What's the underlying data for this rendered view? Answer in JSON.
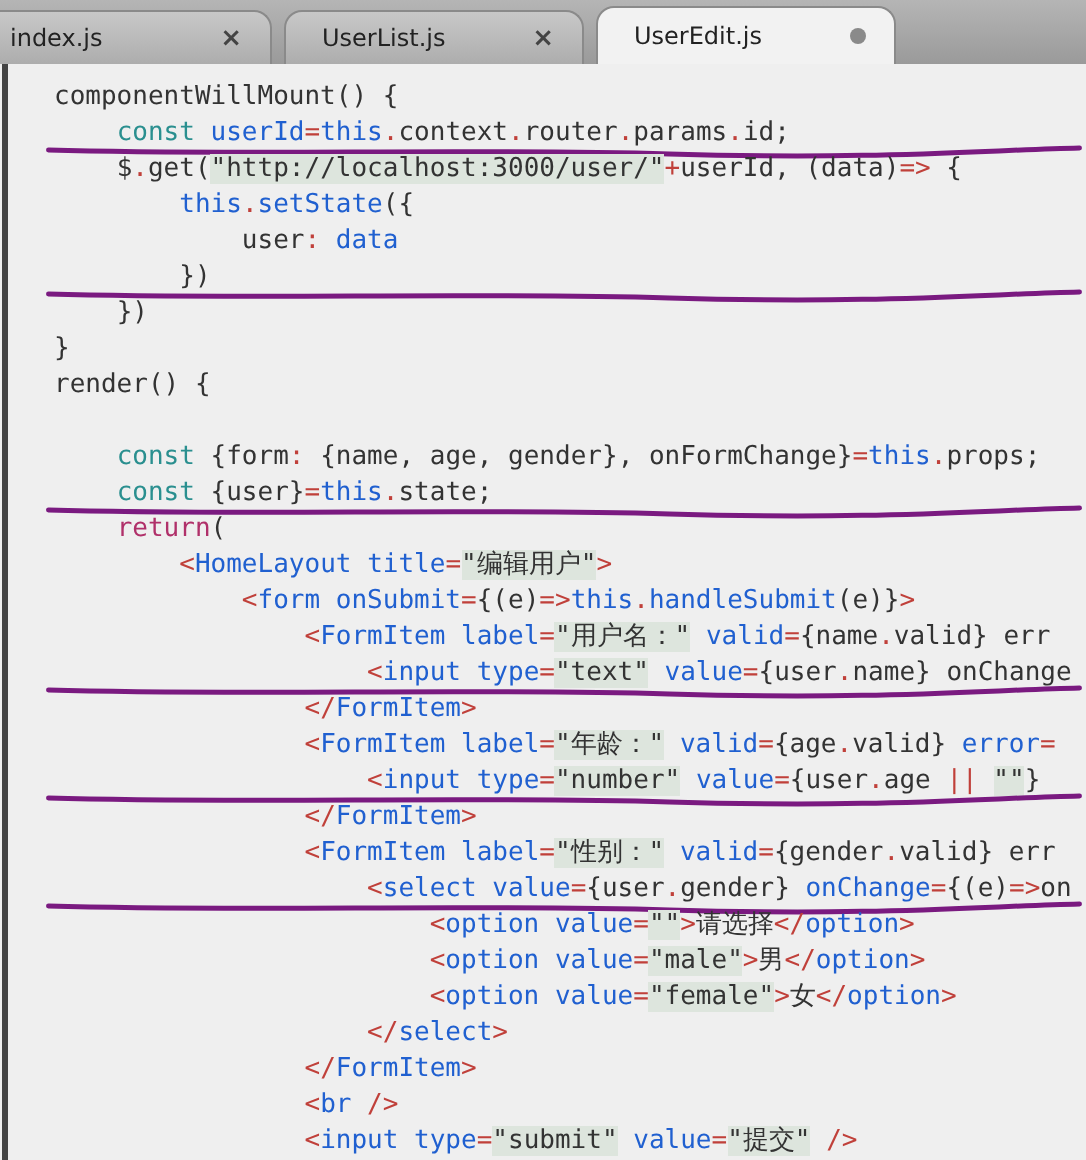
{
  "tabs": [
    {
      "label": "index.js",
      "selected": false,
      "close": "×",
      "modified": false
    },
    {
      "label": "UserList.js",
      "selected": false,
      "close": "×",
      "modified": false
    },
    {
      "label": "UserEdit.js",
      "selected": true,
      "modified": true
    }
  ],
  "lines": [
    {
      "kind": "code",
      "text": "componentWillMount() {",
      "annotated": false
    },
    {
      "kind": "code",
      "text": "    const userId=this.context.router.params.id;",
      "annotated": true
    },
    {
      "kind": "code",
      "text": "    $.get(\"http://localhost:3000/user/\"+userId, (data)=> {",
      "annotated": false
    },
    {
      "kind": "code",
      "text": "        this.setState({",
      "annotated": false
    },
    {
      "kind": "code",
      "text": "            user: data",
      "annotated": false
    },
    {
      "kind": "code",
      "text": "        })",
      "annotated": true
    },
    {
      "kind": "code",
      "text": "    })",
      "annotated": false
    },
    {
      "kind": "code",
      "text": "}",
      "annotated": false
    },
    {
      "kind": "code",
      "text": "render() {",
      "annotated": false
    },
    {
      "kind": "blank"
    },
    {
      "kind": "code",
      "text": "    const {form: {name, age, gender}, onFormChange}=this.props;",
      "annotated": false
    },
    {
      "kind": "code",
      "text": "    const {user}=this.state;",
      "annotated": true
    },
    {
      "kind": "code",
      "text": "    return(",
      "annotated": false
    },
    {
      "kind": "code",
      "text": "        <HomeLayout title=\"编辑用户\">",
      "annotated": false
    },
    {
      "kind": "code",
      "text": "            <form onSubmit={(e)=>this.handleSubmit(e)}>",
      "annotated": false
    },
    {
      "kind": "code",
      "text": "                <FormItem label=\"用户名：\" valid={name.valid} err",
      "annotated": false
    },
    {
      "kind": "code",
      "text": "                    <input type=\"text\" value={user.name} onChange",
      "annotated": true
    },
    {
      "kind": "code",
      "text": "                </FormItem>",
      "annotated": false
    },
    {
      "kind": "code",
      "text": "                <FormItem label=\"年龄：\" valid={age.valid} error=",
      "annotated": false
    },
    {
      "kind": "code",
      "text": "                    <input type=\"number\" value={user.age || \"\"}",
      "annotated": true
    },
    {
      "kind": "code",
      "text": "                </FormItem>",
      "annotated": false
    },
    {
      "kind": "code",
      "text": "                <FormItem label=\"性别：\" valid={gender.valid} err",
      "annotated": false
    },
    {
      "kind": "code",
      "text": "                    <select value={user.gender} onChange={(e)=>on",
      "annotated": true
    },
    {
      "kind": "code",
      "text": "                        <option value=\"\">请选择</option>",
      "annotated": false
    },
    {
      "kind": "code",
      "text": "                        <option value=\"male\">男</option>",
      "annotated": false
    },
    {
      "kind": "code",
      "text": "                        <option value=\"female\">女</option>",
      "annotated": false
    },
    {
      "kind": "code",
      "text": "                    </select>",
      "annotated": false
    },
    {
      "kind": "code",
      "text": "                </FormItem>",
      "annotated": false
    },
    {
      "kind": "code",
      "text": "                <br />",
      "annotated": false
    },
    {
      "kind": "code",
      "text": "                <input type=\"submit\" value=\"提交\" />",
      "annotated": false
    }
  ]
}
